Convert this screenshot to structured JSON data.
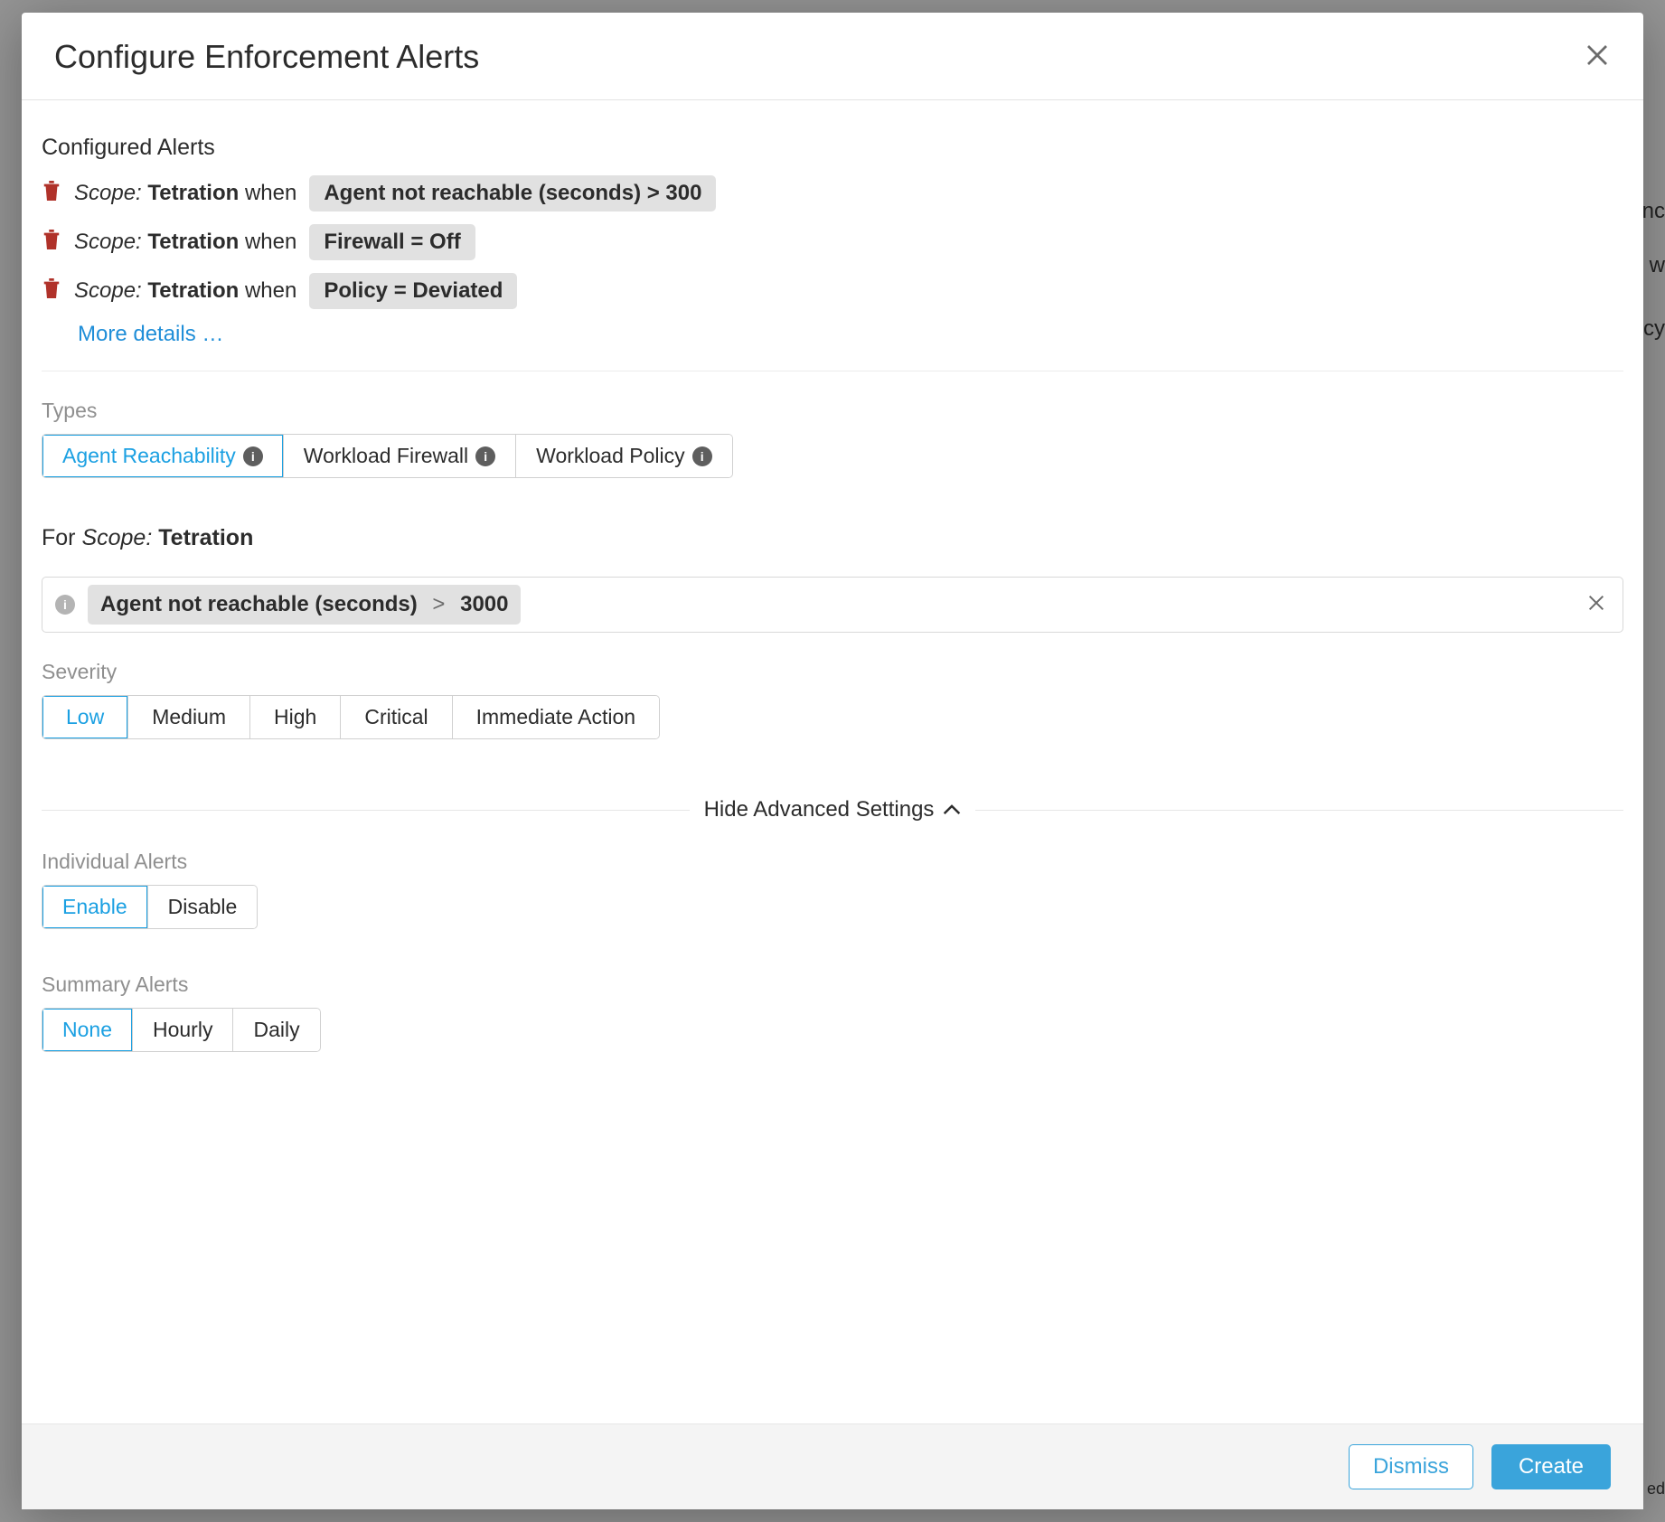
{
  "bg_fragments": [
    "nc",
    "w",
    "cy",
    "ed"
  ],
  "modal": {
    "title": "Configure Enforcement Alerts"
  },
  "configured": {
    "heading": "Configured Alerts",
    "alerts": [
      {
        "scope_label": "Scope:",
        "scope_value": "Tetration",
        "when": "when",
        "condition": "Agent not reachable (seconds) > 300"
      },
      {
        "scope_label": "Scope:",
        "scope_value": "Tetration",
        "when": "when",
        "condition": "Firewall = Off"
      },
      {
        "scope_label": "Scope:",
        "scope_value": "Tetration",
        "when": "when",
        "condition": "Policy = Deviated"
      }
    ],
    "more_details": "More details …"
  },
  "types": {
    "heading": "Types",
    "options": [
      "Agent Reachability",
      "Workload Firewall",
      "Workload Policy"
    ],
    "selected_index": 0
  },
  "for_scope": {
    "prefix": "For",
    "scope_label": "Scope:",
    "scope_value": "Tetration"
  },
  "condition_input": {
    "metric": "Agent not reachable (seconds)",
    "operator": ">",
    "value": "3000"
  },
  "severity": {
    "heading": "Severity",
    "options": [
      "Low",
      "Medium",
      "High",
      "Critical",
      "Immediate Action"
    ],
    "selected_index": 0
  },
  "advanced_toggle": {
    "label": "Hide Advanced Settings"
  },
  "individual_alerts": {
    "heading": "Individual Alerts",
    "options": [
      "Enable",
      "Disable"
    ],
    "selected_index": 0
  },
  "summary_alerts": {
    "heading": "Summary Alerts",
    "options": [
      "None",
      "Hourly",
      "Daily"
    ],
    "selected_index": 0
  },
  "footer": {
    "dismiss": "Dismiss",
    "create": "Create"
  }
}
